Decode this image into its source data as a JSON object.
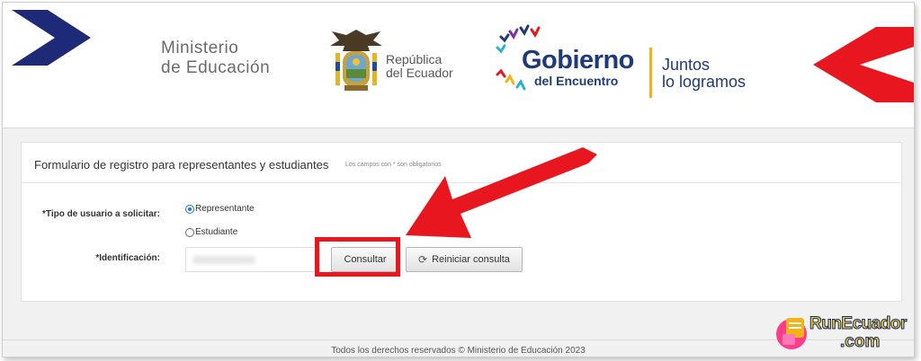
{
  "header": {
    "ministry_line1": "Ministerio",
    "ministry_line2": "de Educación",
    "republic_line1": "República",
    "republic_line2": "del Ecuador",
    "gobierno_title": "Gobierno",
    "gobierno_sub": "del Encuentro",
    "slogan_line1": "Juntos",
    "slogan_line2": "lo logramos"
  },
  "form": {
    "title": "Formulario de registro para representantes y estudiantes",
    "note": "Los campos con * son obligatorios",
    "tipo_label": "*Tipo de usuario a solicitar:",
    "option_representante": "Representante",
    "option_estudiante": "Estudiante",
    "selected_option": "Representante",
    "id_label": "*Identificación:",
    "id_value": "",
    "consultar_label": "Consultar",
    "reiniciar_label": "Reiniciar consulta"
  },
  "footer": {
    "text": "Todos los derechos reservados © Ministerio de Educación 2023"
  },
  "watermark": {
    "line1": "RunEcuador",
    "line2": ".com"
  },
  "colors": {
    "highlight_red": "#e8161e",
    "brand_navy": "#1f3a7a",
    "accent_yellow": "#f2b316"
  }
}
